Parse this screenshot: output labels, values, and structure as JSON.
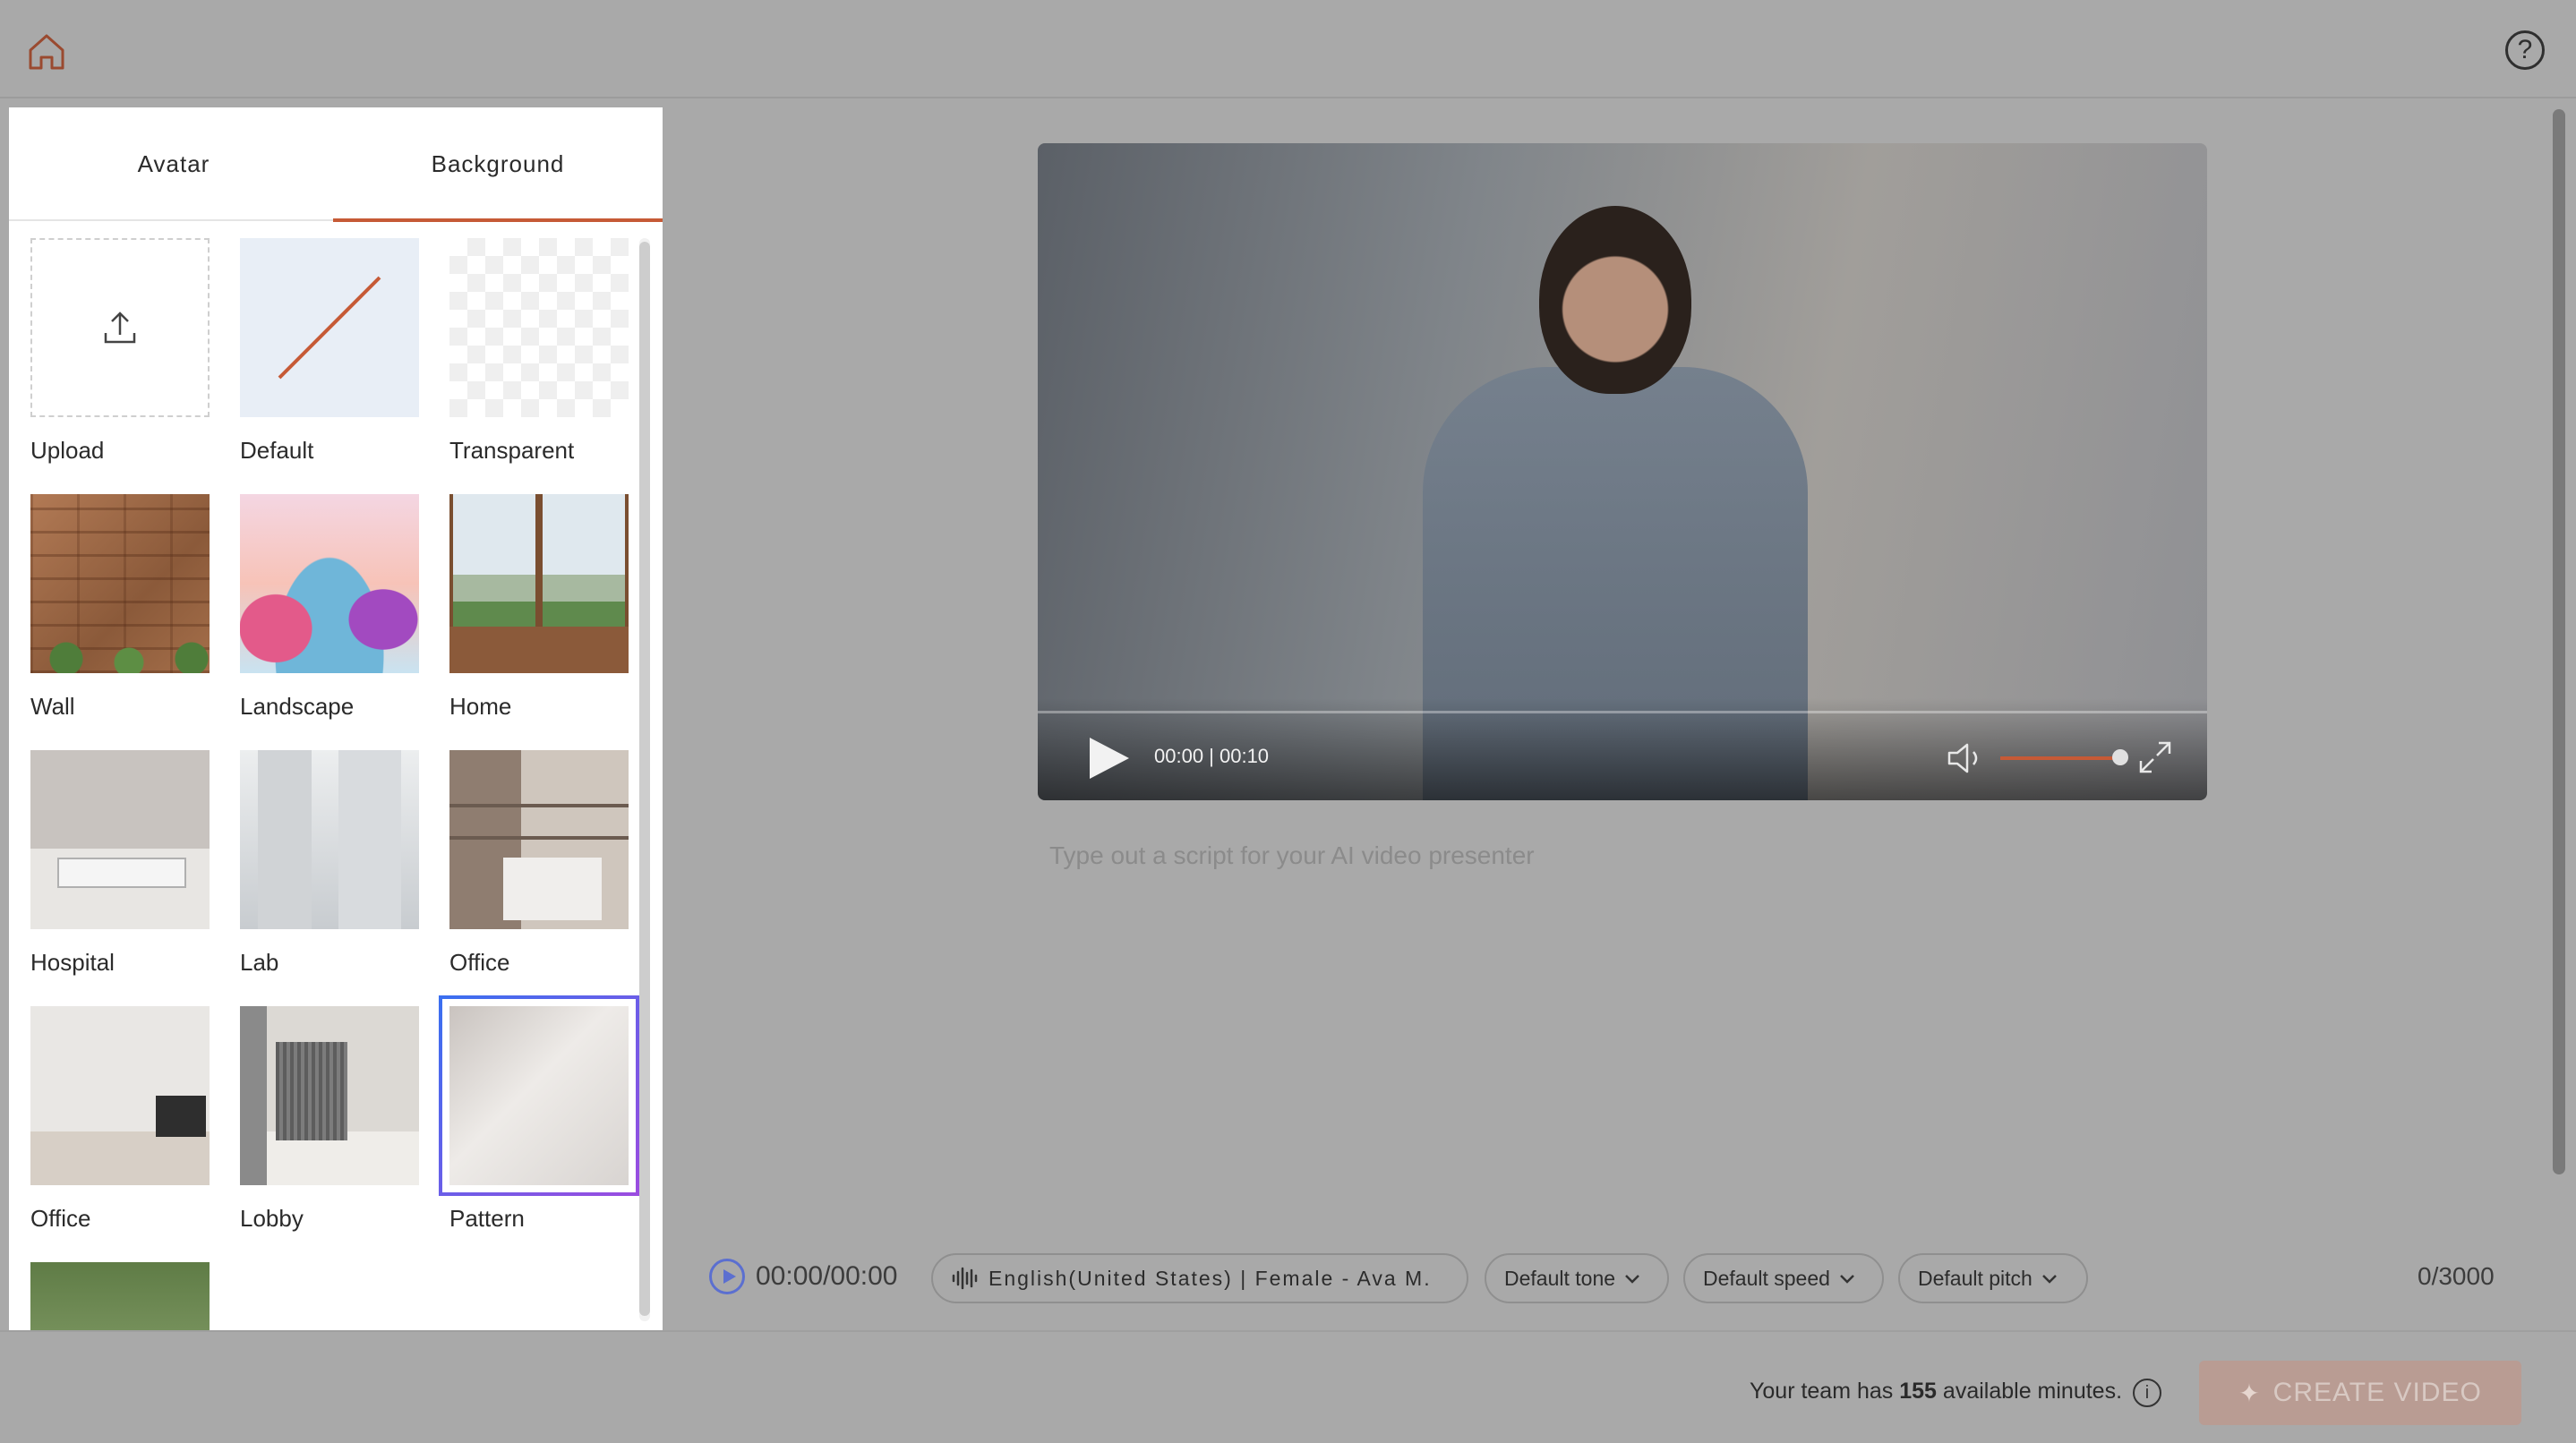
{
  "tabs": [
    {
      "label": "Avatar",
      "active": false
    },
    {
      "label": "Background",
      "active": true
    }
  ],
  "backgrounds": [
    {
      "label": "Upload"
    },
    {
      "label": "Default"
    },
    {
      "label": "Transparent"
    },
    {
      "label": "Wall"
    },
    {
      "label": "Landscape"
    },
    {
      "label": "Home"
    },
    {
      "label": "Hospital"
    },
    {
      "label": "Lab"
    },
    {
      "label": "Office"
    },
    {
      "label": "Office"
    },
    {
      "label": "Lobby"
    },
    {
      "label": "Pattern",
      "selected": true
    }
  ],
  "player": {
    "time": "00:00 | 00:10"
  },
  "script": {
    "placeholder": "Type out a script for your AI video presenter",
    "value": ""
  },
  "audio_preview": {
    "time": "00:00/00:00"
  },
  "voice": {
    "label": "English(United States) | Female - Ava M."
  },
  "tone": {
    "label": "Default tone"
  },
  "speed": {
    "label": "Default speed"
  },
  "pitch": {
    "label": "Default pitch"
  },
  "char_count": "0/3000",
  "footer": {
    "minutes_prefix": "Your team has",
    "minutes_value": "155",
    "minutes_suffix": "available minutes.",
    "create_label": "CREATE VIDEO"
  },
  "colors": {
    "accent": "#c65a36",
    "selection_ring": "#7b4fe0",
    "overlay_bg": "#a9a9a9"
  },
  "icons": {
    "home": "home-icon",
    "help": "help-icon",
    "upload": "upload-icon",
    "play": "play-icon",
    "volume": "volume-icon",
    "fullscreen": "fullscreen-icon",
    "waveform": "waveform-icon",
    "chevron": "chevron-down-icon",
    "info": "info-icon",
    "sparkle": "sparkle-icon"
  }
}
